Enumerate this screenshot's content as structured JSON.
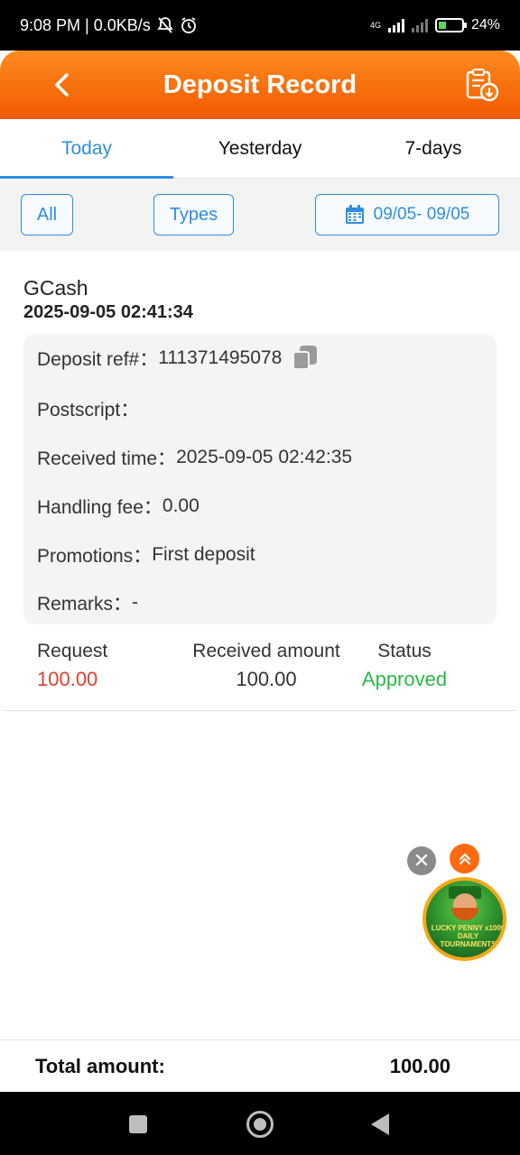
{
  "status_bar": {
    "time_info": "9:08 PM | 0.0KB/s",
    "network_label": "4G",
    "battery": "24%"
  },
  "header": {
    "title": "Deposit Record"
  },
  "tabs": [
    {
      "label": "Today",
      "active": true
    },
    {
      "label": "Yesterday",
      "active": false
    },
    {
      "label": "7-days",
      "active": false
    }
  ],
  "filters": {
    "all_label": "All",
    "types_label": "Types",
    "date_range": "09/05- 09/05"
  },
  "record": {
    "method": "GCash",
    "created_time": "2025-09-05 02:41:34",
    "details": {
      "ref_label": "Deposit ref#：",
      "ref_value": "111371495078",
      "postscript_label": "Postscript：",
      "postscript_value": "",
      "received_time_label": "Received time：",
      "received_time_value": "2025-09-05 02:42:35",
      "fee_label": "Handling fee：",
      "fee_value": "0.00",
      "promo_label": "Promotions：",
      "promo_value": "First deposit",
      "remarks_label": "Remarks：",
      "remarks_value": "-"
    },
    "summary": {
      "request_label": "Request",
      "request_value": "100.00",
      "received_label": "Received amount",
      "received_value": "100.00",
      "status_label": "Status",
      "status_value": "Approved"
    }
  },
  "promo_float": {
    "text": "LUCKY PENNY x1000 DAILY TOURNAMENTS"
  },
  "total": {
    "label": "Total amount:",
    "value": "100.00"
  },
  "colors": {
    "accent": "#2e8ee0",
    "header": "#f25a00",
    "request": "#e0402a",
    "approved": "#2ab84a"
  }
}
